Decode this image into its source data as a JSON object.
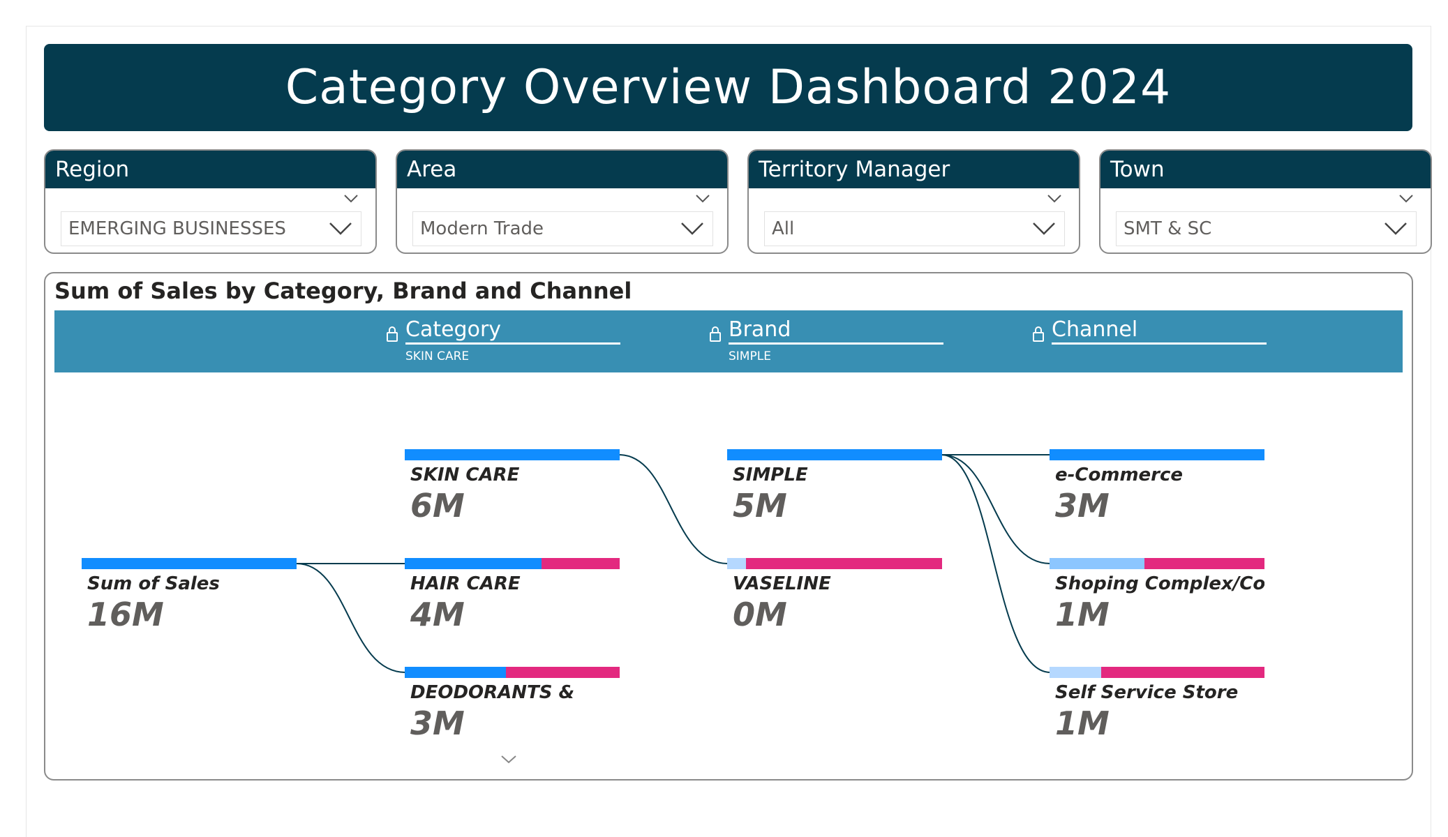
{
  "dashboard": {
    "title": "Category Overview Dashboard 2024"
  },
  "slicers": [
    {
      "header": "Region",
      "value": "EMERGING BUSINESSES"
    },
    {
      "header": "Area",
      "value": "Modern Trade"
    },
    {
      "header": "Territory Manager",
      "value": "All"
    },
    {
      "header": "Town",
      "value": "SMT & SC"
    }
  ],
  "tree": {
    "title": "Sum of Sales by Category, Brand and Channel",
    "levels": [
      {
        "name": "Category",
        "selected": "SKIN CARE"
      },
      {
        "name": "Brand",
        "selected": "SIMPLE"
      },
      {
        "name": "Channel",
        "selected": ""
      }
    ],
    "root": {
      "label": "Sum of Sales",
      "value": "16M"
    },
    "category_nodes": [
      {
        "label": "SKIN CARE",
        "value": "6M"
      },
      {
        "label": "HAIR CARE",
        "value": "4M"
      },
      {
        "label": "DEODORANTS &",
        "value": "3M"
      }
    ],
    "brand_nodes": [
      {
        "label": "SIMPLE",
        "value": "5M"
      },
      {
        "label": "VASELINE",
        "value": "0M"
      }
    ],
    "channel_nodes": [
      {
        "label": "e-Commerce",
        "value": "3M"
      },
      {
        "label": "Shoping Complex/Cosm...",
        "value": "1M"
      },
      {
        "label": "Self Service Store",
        "value": "1M"
      }
    ],
    "colors": {
      "positive": "#118dff",
      "negative": "#e3297f",
      "faded_1": "#8cc6ff",
      "faded_2": "#b5d8ff",
      "link": "#053b4e"
    }
  },
  "chart_data": {
    "type": "decomposition_tree",
    "title": "Sum of Sales by Category, Brand and Channel",
    "root": {
      "name": "Sum of Sales",
      "value": 16000000
    },
    "levels": [
      {
        "name": "Category",
        "nodes": [
          {
            "name": "SKIN CARE",
            "value": 6000000,
            "bar_fill": 1.0,
            "expanded": true
          },
          {
            "name": "HAIR CARE",
            "value": 4000000,
            "bar_fill": 0.63
          },
          {
            "name": "DEODORANTS &",
            "value": 3000000,
            "bar_fill": 0.47
          }
        ]
      },
      {
        "name": "Brand",
        "parent": "SKIN CARE",
        "nodes": [
          {
            "name": "SIMPLE",
            "value": 5000000,
            "bar_fill": 1.0,
            "expanded": true
          },
          {
            "name": "VASELINE",
            "value": 0,
            "bar_fill": 0.09
          }
        ]
      },
      {
        "name": "Channel",
        "parent": "SIMPLE",
        "nodes": [
          {
            "name": "e-Commerce",
            "value": 3000000,
            "bar_fill": 1.0
          },
          {
            "name": "Shoping Complex/Cosm...",
            "value": 1000000,
            "bar_fill": 0.44
          },
          {
            "name": "Self Service Store",
            "value": 1000000,
            "bar_fill": 0.24
          }
        ]
      }
    ]
  }
}
